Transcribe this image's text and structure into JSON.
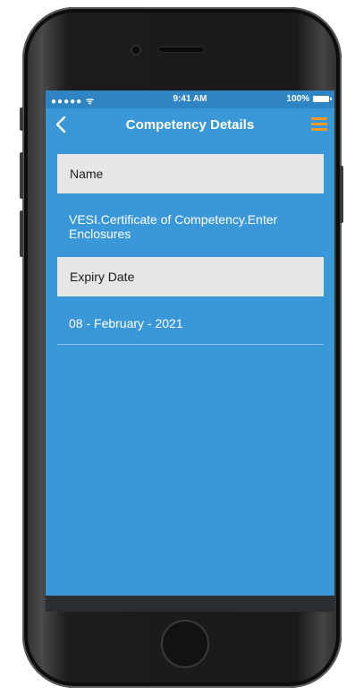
{
  "status_bar": {
    "signal": "●●●●● ᯤ",
    "time": "9:41 AM",
    "battery": "100%"
  },
  "nav": {
    "title": "Competency Details",
    "back_icon": "chevron-left-icon",
    "menu_icon": "hamburger-menu-icon",
    "accent_color": "#f39a24"
  },
  "fields": [
    {
      "label": "Name",
      "value": "VESI.Certificate of Competency.Enter Enclosures"
    },
    {
      "label": "Expiry Date",
      "value": "08 - February - 2021"
    }
  ],
  "colors": {
    "screen_background": "#3a97d8",
    "field_header_background": "#e6e6e6"
  }
}
